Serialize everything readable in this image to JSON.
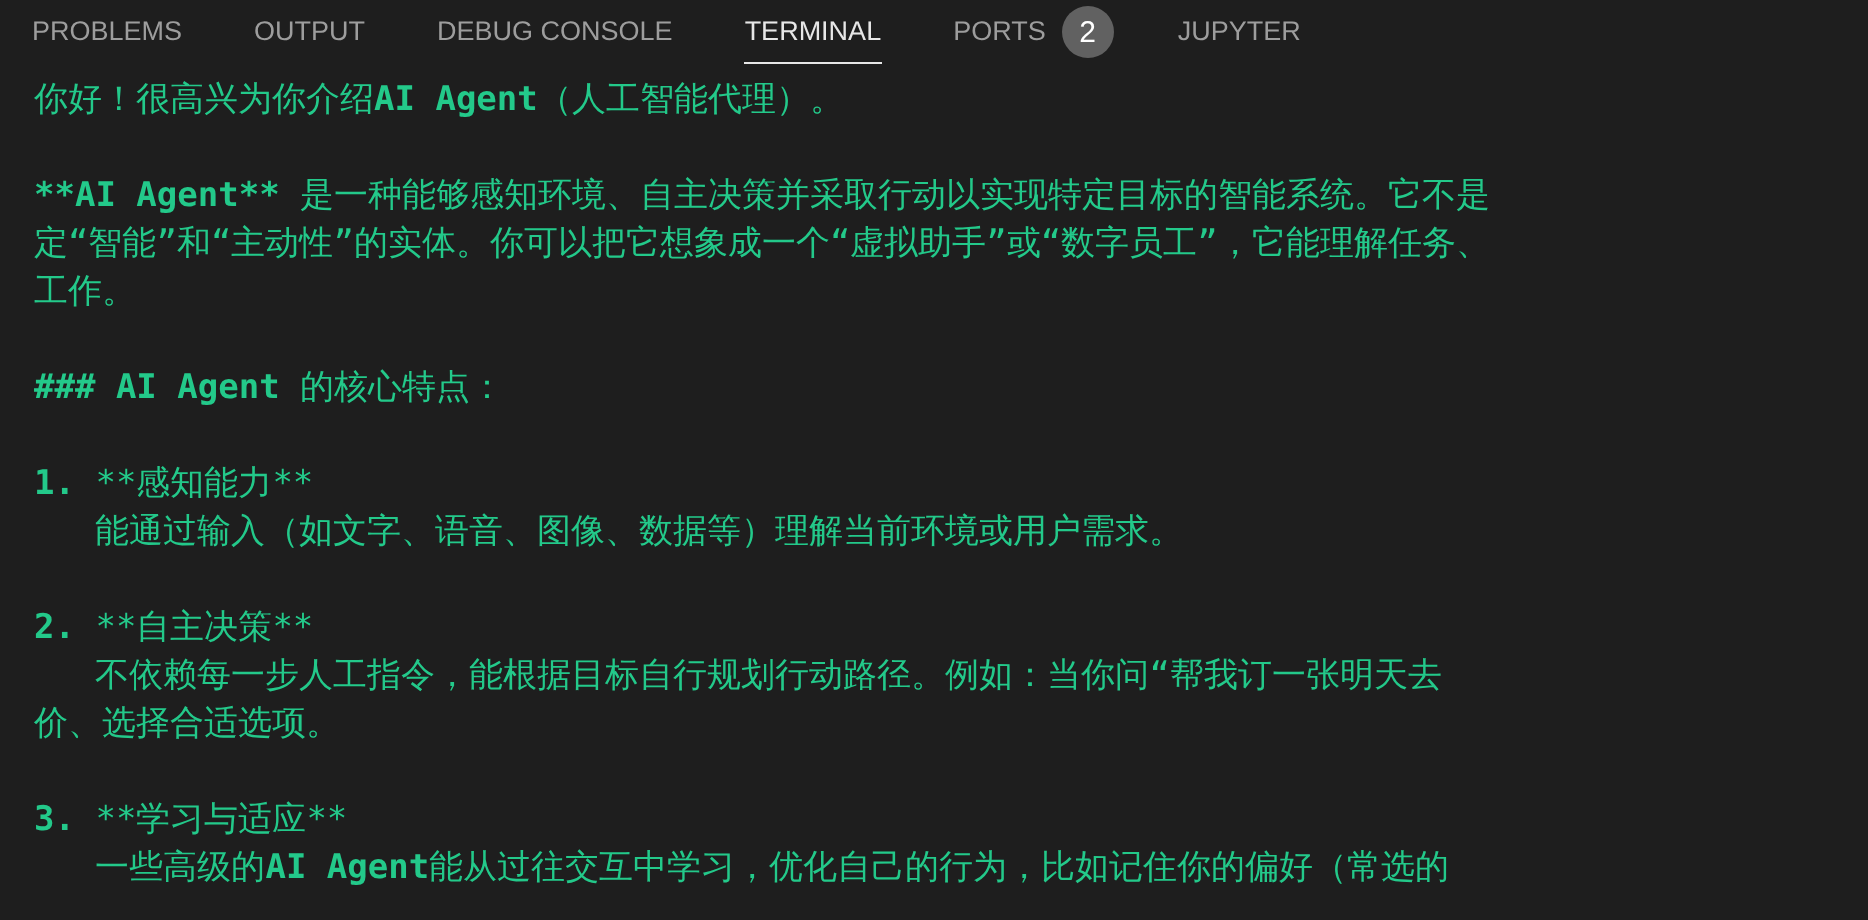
{
  "panel_tabs": [
    {
      "label": "PROBLEMS",
      "selected": false
    },
    {
      "label": "OUTPUT",
      "selected": false
    },
    {
      "label": "DEBUG CONSOLE",
      "selected": false
    },
    {
      "label": "TERMINAL",
      "selected": true
    },
    {
      "label": "PORTS",
      "selected": false,
      "badge": "2"
    },
    {
      "label": "JUPYTER",
      "selected": false
    }
  ],
  "terminal": {
    "paragraphs": [
      {
        "lines": [
          [
            {
              "text": "你好！很高兴为你介绍",
              "bold": false
            },
            {
              "text": "AI Agent",
              "bold": true
            },
            {
              "text": "（人工智能代理）。",
              "bold": false
            }
          ]
        ]
      },
      {
        "lines": [
          [
            {
              "text": "**AI Agent**",
              "bold": true
            },
            {
              "text": " 是一种能够感知环境、自主决策并采取行动以实现特定目标的智能系统。它不是",
              "bold": false
            }
          ],
          [
            {
              "text": "定“智能”和“主动性”的实体。你可以把它想象成一个“虚拟助手”或“数字员工”，它能理解任务、",
              "bold": false
            }
          ],
          [
            {
              "text": "工作。",
              "bold": false
            }
          ]
        ]
      },
      {
        "lines": [
          [
            {
              "text": "### AI Agent",
              "bold": true
            },
            {
              "text": " 的核心特点：",
              "bold": false
            }
          ]
        ]
      },
      {
        "lines": [
          [
            {
              "text": "1.",
              "bold": true
            },
            {
              "text": " **感知能力**",
              "bold": false
            }
          ],
          [
            {
              "text": "   能通过输入（如文字、语音、图像、数据等）理解当前环境或用户需求。",
              "bold": false
            }
          ]
        ]
      },
      {
        "lines": [
          [
            {
              "text": "2.",
              "bold": true
            },
            {
              "text": " **自主决策**",
              "bold": false
            }
          ],
          [
            {
              "text": "   不依赖每一步人工指令，能根据目标自行规划行动路径。例如：当你问“帮我订一张明天去",
              "bold": false
            }
          ],
          [
            {
              "text": "价、选择合适选项。",
              "bold": false
            }
          ]
        ]
      },
      {
        "lines": [
          [
            {
              "text": "3.",
              "bold": true
            },
            {
              "text": " **学习与适应**",
              "bold": false
            }
          ],
          [
            {
              "text": "   一些高级的",
              "bold": false
            },
            {
              "text": "AI Agent",
              "bold": true
            },
            {
              "text": "能从过往交互中学习，优化自己的行为，比如记住你的偏好（常选的",
              "bold": false
            }
          ]
        ]
      }
    ]
  }
}
